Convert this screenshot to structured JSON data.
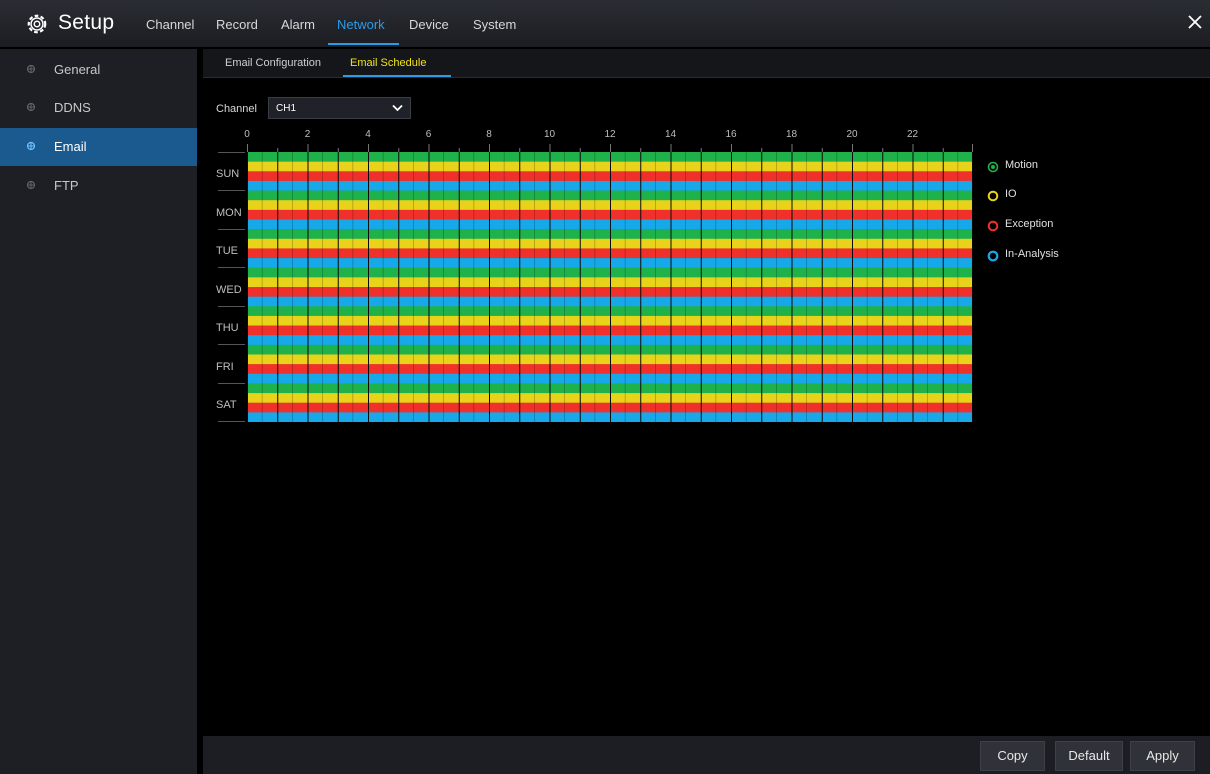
{
  "header": {
    "title": "Setup",
    "menu": [
      {
        "label": "Channel"
      },
      {
        "label": "Record"
      },
      {
        "label": "Alarm"
      },
      {
        "label": "Network"
      },
      {
        "label": "Device"
      },
      {
        "label": "System"
      }
    ],
    "active_menu": "Network"
  },
  "sidebar": {
    "items": [
      {
        "label": "General"
      },
      {
        "label": "DDNS"
      },
      {
        "label": "Email"
      },
      {
        "label": "FTP"
      }
    ],
    "active": "Email"
  },
  "subtabs": [
    {
      "label": "Email Configuration"
    },
    {
      "label": "Email Schedule"
    }
  ],
  "active_subtab": "Email Schedule",
  "channel": {
    "label": "Channel",
    "value": "CH1"
  },
  "schedule": {
    "hours": [
      "0",
      "2",
      "4",
      "6",
      "8",
      "10",
      "12",
      "14",
      "16",
      "18",
      "20",
      "22"
    ],
    "days": [
      "SUN",
      "MON",
      "TUE",
      "WED",
      "THU",
      "FRI",
      "SAT"
    ],
    "types_per_day": [
      "Motion",
      "IO",
      "Exception",
      "In-Analysis"
    ],
    "all_enabled": true
  },
  "legend": [
    {
      "label": "Motion",
      "color": "#1fb24a"
    },
    {
      "label": "IO",
      "color": "#e8d21a"
    },
    {
      "label": "Exception",
      "color": "#f0302b"
    },
    {
      "label": "In-Analysis",
      "color": "#16a8e8"
    }
  ],
  "buttons": {
    "copy": "Copy",
    "default": "Default",
    "apply": "Apply"
  },
  "colors": {
    "accent": "#2c9be6",
    "active_subtab_text": "#f2e21c",
    "sidebar_active": "#1a5a8e"
  }
}
